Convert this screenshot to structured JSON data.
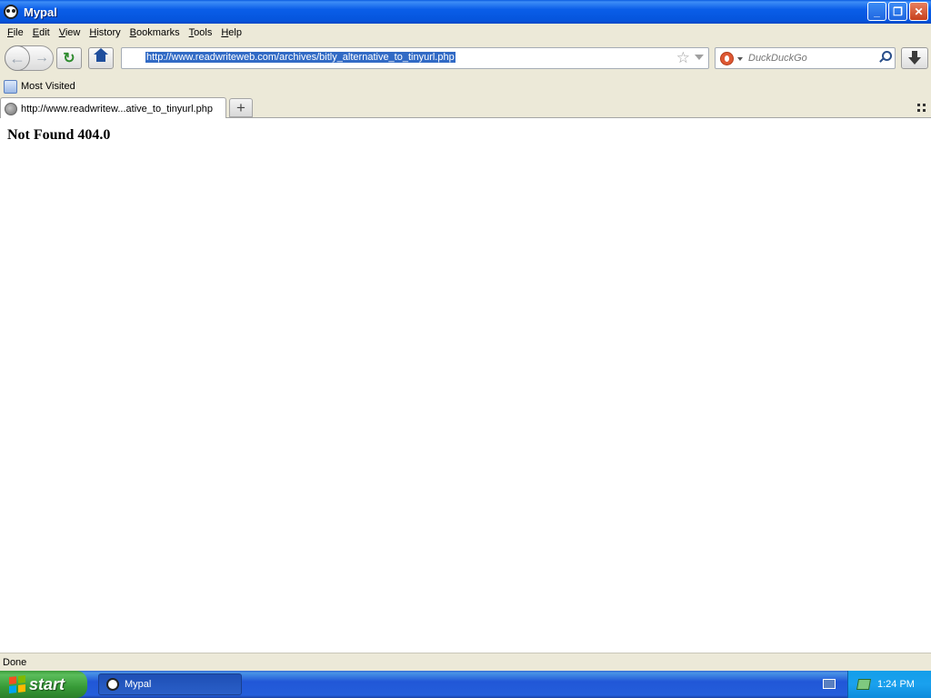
{
  "window": {
    "title": "Mypal",
    "controls": {
      "minimize": "_",
      "maximize": "❐",
      "close": "✕"
    }
  },
  "menu": {
    "items": [
      {
        "label": "File",
        "key": "F",
        "rest": "ile"
      },
      {
        "label": "Edit",
        "key": "E",
        "rest": "dit"
      },
      {
        "label": "View",
        "key": "V",
        "rest": "iew"
      },
      {
        "label": "History",
        "key": "H",
        "rest": "istory"
      },
      {
        "label": "Bookmarks",
        "key": "B",
        "rest": "ookmarks"
      },
      {
        "label": "Tools",
        "key": "T",
        "rest": "ools"
      },
      {
        "label": "Help",
        "key": "H",
        "rest": "elp"
      }
    ]
  },
  "nav": {
    "back_glyph": "←",
    "forward_glyph": "→",
    "reload_glyph": "↻",
    "url": "http://www.readwriteweb.com/archives/bitly_alternative_to_tinyurl.php",
    "star_glyph": "☆",
    "search_placeholder": "DuckDuckGo"
  },
  "bookmarks": {
    "items": [
      {
        "label": "Most Visited"
      }
    ]
  },
  "tabs": {
    "items": [
      {
        "label": "http://www.readwritew...ative_to_tinyurl.php",
        "active": true
      }
    ],
    "new_tab_glyph": "+"
  },
  "page": {
    "heading": "Not Found 404.0"
  },
  "status": {
    "text": "Done"
  },
  "taskbar": {
    "start_label": "start",
    "tasks": [
      {
        "label": "Mypal"
      }
    ],
    "clock": "1:24 PM"
  }
}
